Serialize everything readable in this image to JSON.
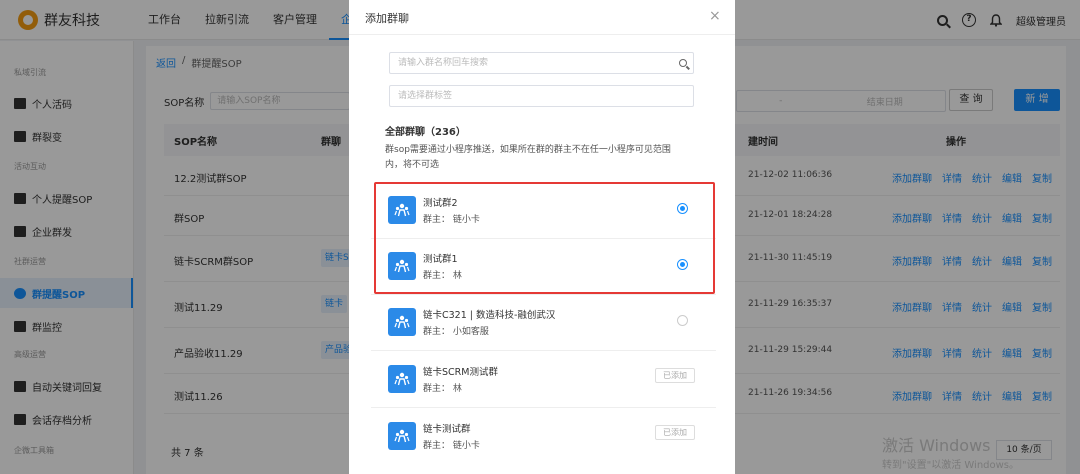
{
  "app": {
    "logo_text": "群友科技"
  },
  "top_nav": [
    {
      "label": "工作台"
    },
    {
      "label": "拉新引流"
    },
    {
      "label": "客户管理"
    },
    {
      "label": "企"
    }
  ],
  "user": {
    "name": "超级管理员"
  },
  "sidebar": {
    "groups": [
      "私域引流",
      "活动互动",
      "社群运营",
      "高级运营",
      "企微工具箱"
    ],
    "items": [
      {
        "label": "个人活码",
        "icon": "qrcode-icon"
      },
      {
        "label": "群裂变",
        "icon": "chart-icon"
      },
      {
        "label": "个人提醒SOP",
        "icon": "sop-icon"
      },
      {
        "label": "企业群发",
        "icon": "mail-icon"
      },
      {
        "label": "群提醒SOP",
        "icon": "group-icon"
      },
      {
        "label": "群监控",
        "icon": "monitor-icon"
      },
      {
        "label": "自动关键词回复",
        "icon": "chat-icon"
      },
      {
        "label": "会话存档分析",
        "icon": "archive-icon"
      }
    ]
  },
  "breadcrumb": {
    "back": "返回",
    "sep": "/",
    "current": "群提醒SOP"
  },
  "filters": {
    "sop_label": "SOP名称",
    "sop_placeholder": "请输入SOP名称",
    "date_sep": "-",
    "date_end": "结束日期",
    "query": "查 询",
    "new": "新 增"
  },
  "table": {
    "headers": {
      "name": "SOP名称",
      "group": "群聊",
      "time": "建时间",
      "ops": "操作"
    },
    "rows": [
      {
        "name": "12.2测试群SOP",
        "tag": "",
        "time": "21-12-02 11:06:36"
      },
      {
        "name": "群SOP",
        "tag": "",
        "time": "21-12-01 18:24:28"
      },
      {
        "name": "链卡SCRM群SOP",
        "tag": "链卡S",
        "time": "21-11-30 11:45:19"
      },
      {
        "name": "测试11.29",
        "tag": "链卡",
        "time": "21-11-29 16:35:37"
      },
      {
        "name": "产品验收11.29",
        "tag": "产品验",
        "time": "21-11-29 15:29:44"
      },
      {
        "name": "测试11.26",
        "tag": "",
        "time": "21-11-26 19:34:56"
      }
    ],
    "ops": [
      "添加群聊",
      "详情",
      "统计",
      "编辑",
      "复制"
    ],
    "total": "共 7 条",
    "page_size": "10 条/页"
  },
  "modal": {
    "title": "添加群聊",
    "close": "×",
    "search_placeholder": "请输入群名称回车搜索",
    "tag_placeholder": "请选择群标签",
    "count": "全部群聊（236）",
    "note": "群sop需要通过小程序推送，如果所在群的群主不在任一小程序可见范围内，将不可选",
    "groups": [
      {
        "name": "测试群2",
        "owner": "群主：  链小卡",
        "state": "selected"
      },
      {
        "name": "测试群1",
        "owner": "群主：  林",
        "state": "selected"
      },
      {
        "name": "链卡C321 | 数造科技-融创武汉",
        "owner": "群主：  小如客服",
        "state": "unselected"
      },
      {
        "name": "链卡SCRM测试群",
        "owner": "群主：  林",
        "state": "added",
        "added_label": "已添加"
      },
      {
        "name": "链卡测试群",
        "owner": "群主：  链小卡",
        "state": "added",
        "added_label": "已添加"
      }
    ]
  },
  "watermark": {
    "line1": "激活 Windows",
    "line2": "转到\"设置\"以激活 Windows。"
  }
}
